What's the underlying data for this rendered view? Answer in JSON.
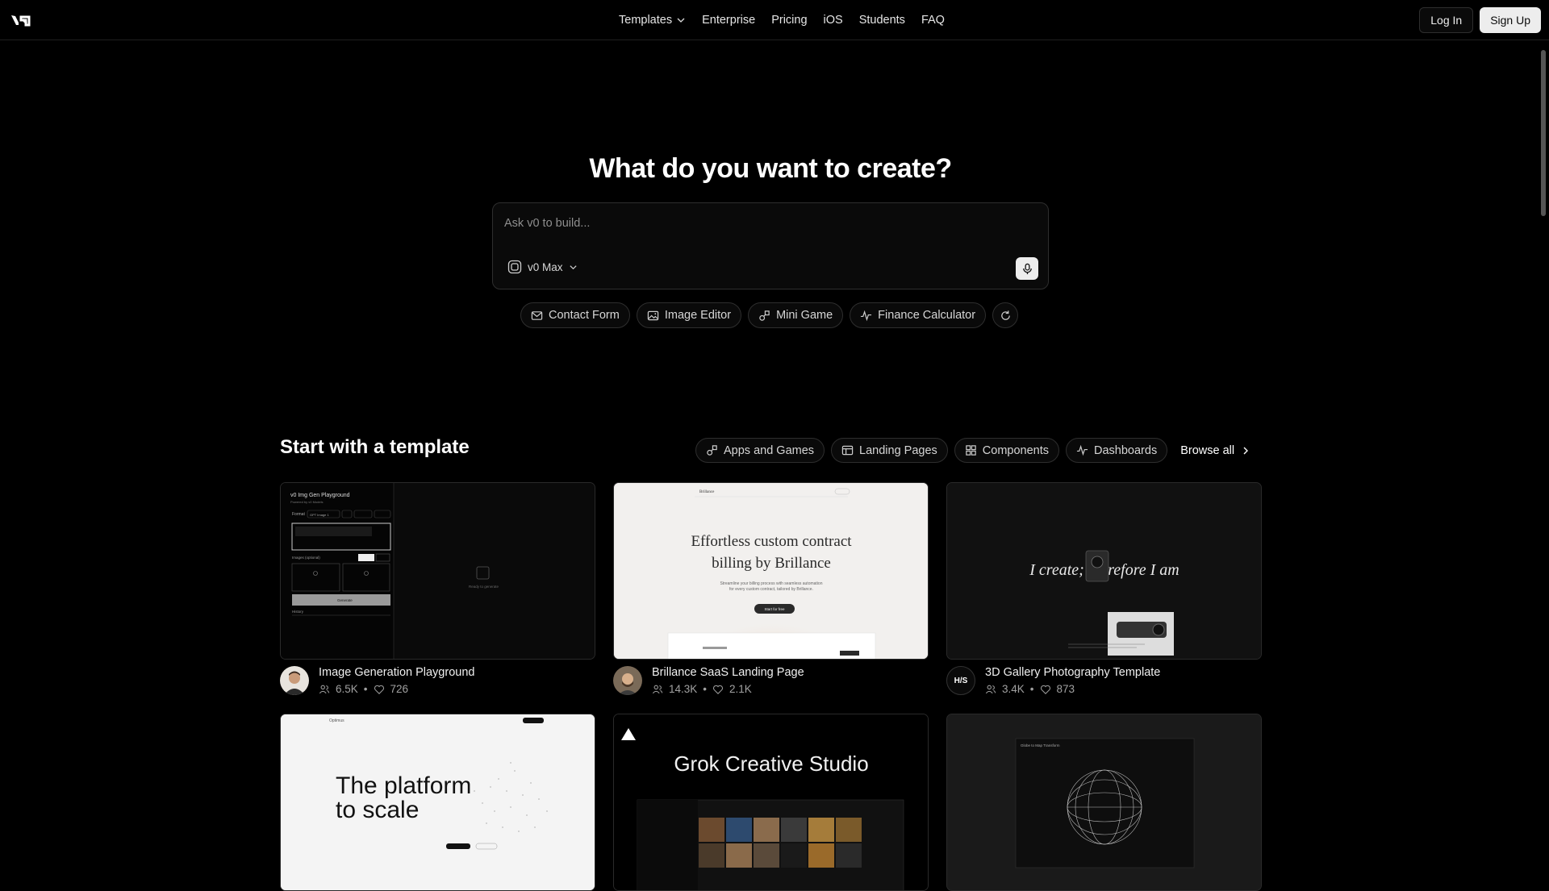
{
  "nav": {
    "items": [
      {
        "label": "Templates",
        "has_dropdown": true
      },
      {
        "label": "Enterprise"
      },
      {
        "label": "Pricing"
      },
      {
        "label": "iOS"
      },
      {
        "label": "Students"
      },
      {
        "label": "FAQ"
      }
    ],
    "login_label": "Log In",
    "signup_label": "Sign Up"
  },
  "hero": {
    "title": "What do you want to create?",
    "prompt_placeholder": "Ask v0 to build...",
    "model_label": "v0 Max",
    "suggestions": [
      "Contact Form",
      "Image Editor",
      "Mini Game",
      "Finance Calculator"
    ]
  },
  "templates": {
    "title": "Start with a template",
    "filters": [
      "Apps and Games",
      "Landing Pages",
      "Components",
      "Dashboards"
    ],
    "browse_all": "Browse all",
    "cards": [
      {
        "title": "Image Generation Playground",
        "users": "6.5K",
        "likes": "726",
        "thumb": {
          "header": "v0 Img Gen Playground",
          "sub": "Powered by v0 Models",
          "model_label": "Format",
          "model_value": "GPT Image 1",
          "generate_label": "Generate",
          "images_label": "Images (optional)",
          "history_label": "History",
          "empty_label": "Ready to generate"
        }
      },
      {
        "title": "Brillance SaaS Landing Page",
        "users": "14.3K",
        "likes": "2.1K",
        "thumb": {
          "brand": "Brillance",
          "headline_1": "Effortless custom contract",
          "headline_2": "billing by Brillance",
          "sub_1": "Streamline your billing process with seamless automation",
          "sub_2": "for every custom contract, tailored by Brillance.",
          "cta": "Start for free"
        }
      },
      {
        "title": "3D Gallery Photography Template",
        "users": "3.4K",
        "likes": "873",
        "avatar_text": "H/S",
        "thumb": {
          "headline": "I create; therefore I am"
        }
      },
      {
        "title": "",
        "thumb": {
          "brand": "Optimus",
          "headline_1": "The platform",
          "headline_2": "to scale"
        }
      },
      {
        "title": "",
        "thumb": {
          "headline": "Grok Creative Studio"
        }
      },
      {
        "title": "",
        "thumb": {
          "heading": "Globe to Map Transform"
        }
      }
    ]
  },
  "colors": {
    "background": "#000000",
    "border": "#2e2e2e",
    "text": "#ededed",
    "muted": "#a1a1a1"
  }
}
